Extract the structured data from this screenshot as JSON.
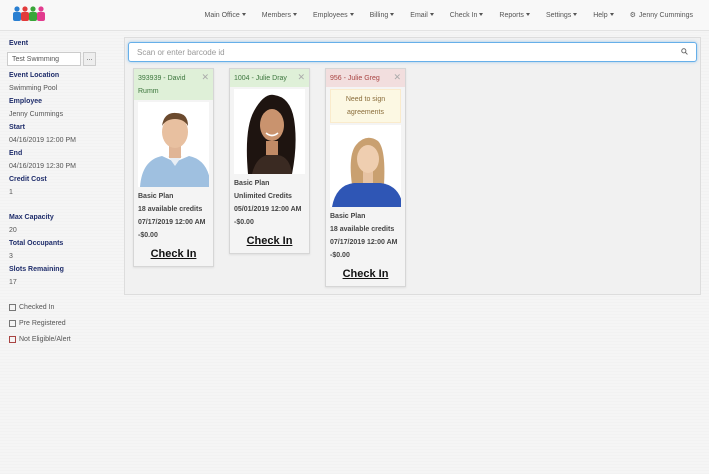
{
  "nav": {
    "items": [
      "Main Office",
      "Members",
      "Employees",
      "Billing",
      "Email",
      "Check In",
      "Reports",
      "Settings",
      "Help"
    ],
    "user": "Jenny Cummings"
  },
  "sidebar": {
    "event_label": "Event",
    "event_value": "Test Swimming",
    "browse_label": "...",
    "location_label": "Event Location",
    "location_value": "Swimming Pool",
    "employee_label": "Employee",
    "employee_value": "Jenny Cummings",
    "start_label": "Start",
    "start_value": "04/16/2019 12:00 PM",
    "end_label": "End",
    "end_value": "04/16/2019 12:30 PM",
    "credit_label": "Credit Cost",
    "credit_value": "1",
    "max_label": "Max Capacity",
    "max_value": "20",
    "occupants_label": "Total Occupants",
    "occupants_value": "3",
    "slots_label": "Slots Remaining",
    "slots_value": "17",
    "legend": [
      "Checked In",
      "Pre Registered",
      "Not Eligible/Alert"
    ]
  },
  "search": {
    "placeholder": "Scan or enter barcode id"
  },
  "cards": [
    {
      "header": "393939 - David Rumm",
      "plan": "Basic Plan",
      "credits": "18 available credits",
      "date": "07/17/2019 12:00 AM",
      "balance": "-$0.00",
      "action": "Check In"
    },
    {
      "header": "1004 - Julie Dray",
      "plan": "Basic Plan",
      "credits": "Unlimited Credits",
      "date": "05/01/2019 12:00 AM",
      "balance": "-$0.00",
      "action": "Check In"
    },
    {
      "header": "956 - Julie Greg",
      "alert": "Need to sign agreements",
      "plan": "Basic Plan",
      "credits": "18 available credits",
      "date": "07/17/2019 12:00 AM",
      "balance": "-$0.00",
      "action": "Check In"
    }
  ],
  "colors": {
    "label_navy": "#1f2d6b",
    "header_green": "#dff0d8",
    "header_red": "#f2dede",
    "alert_yellow": "#fcf8e3",
    "search_border": "#66afe9"
  }
}
